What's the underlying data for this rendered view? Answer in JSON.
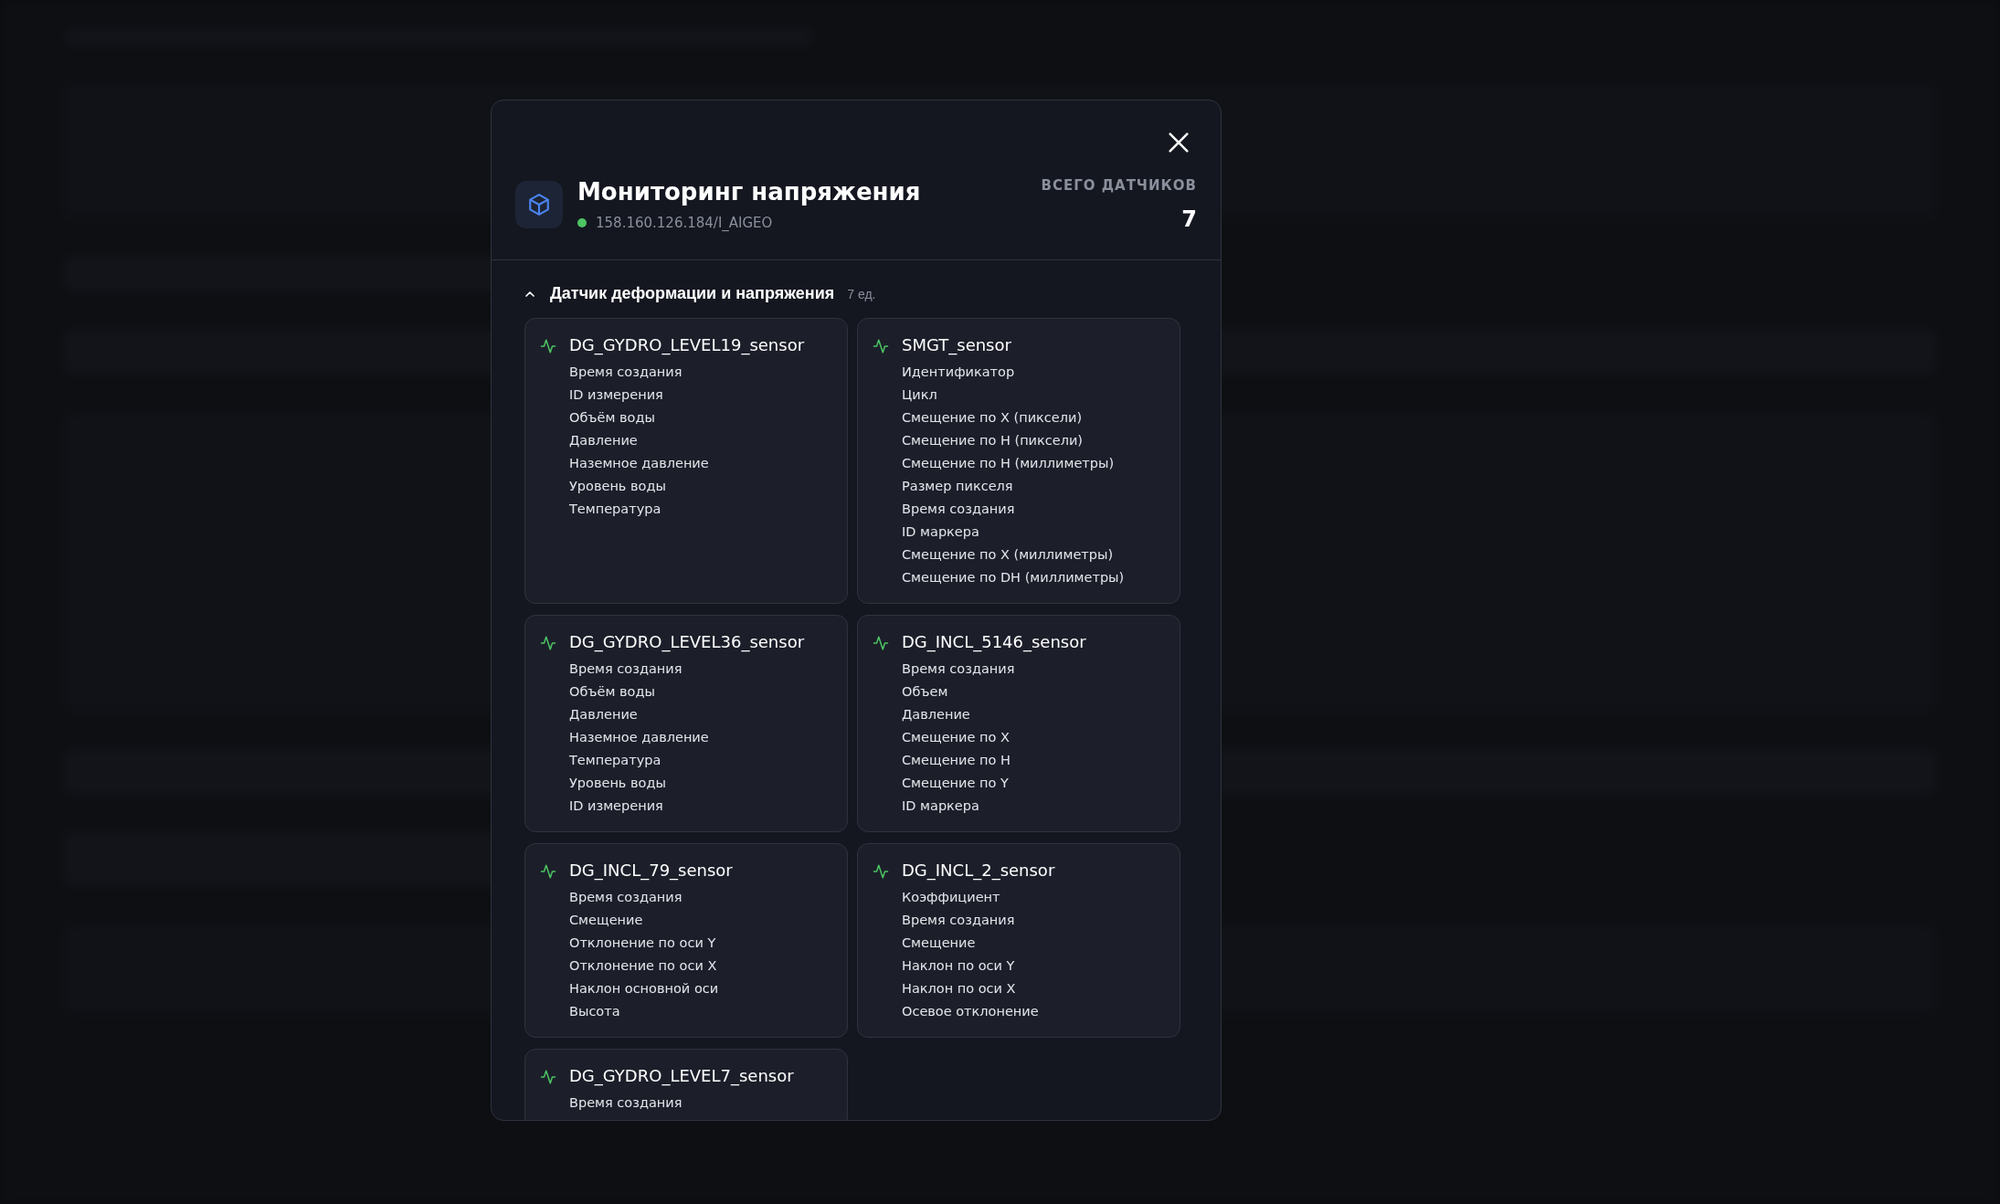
{
  "dialog": {
    "title": "Мониторинг напряжения",
    "address": "158.160.126.184/I_AIGEO",
    "total_label": "ВСЕГО ДАТЧИКОВ",
    "total_value": "7",
    "group": {
      "name": "Датчик деформации и напряжения",
      "count": "7 ед.",
      "expanded": true,
      "sensors": [
        {
          "name": "DG_GYDRO_LEVEL19_sensor",
          "fields": [
            "Время создания",
            "ID измерения",
            "Объём воды",
            "Давление",
            "Наземное давление",
            "Уровень воды",
            "Температура"
          ]
        },
        {
          "name": "SMGT_sensor",
          "fields": [
            "Идентификатор",
            "Цикл",
            "Смещение по X (пиксели)",
            "Смещение по H (пиксели)",
            "Смещение по H (миллиметры)",
            "Размер пикселя",
            "Время создания",
            "ID маркера",
            "Смещение по X (миллиметры)",
            "Смещение по DH (миллиметры)"
          ]
        },
        {
          "name": "DG_GYDRO_LEVEL36_sensor",
          "fields": [
            "Время создания",
            "Объём воды",
            "Давление",
            "Наземное давление",
            "Температура",
            "Уровень воды",
            "ID измерения"
          ]
        },
        {
          "name": "DG_INCL_5146_sensor",
          "fields": [
            "Время создания",
            "Объем",
            "Давление",
            "Смещение по X",
            "Смещение по H",
            "Смещение по Y",
            "ID маркера"
          ]
        },
        {
          "name": "DG_INCL_79_sensor",
          "fields": [
            "Время создания",
            "Смещение",
            "Отклонение по оси Y",
            "Отклонение по оси X",
            "Наклон основной оси",
            "Высота"
          ]
        },
        {
          "name": "DG_INCL_2_sensor",
          "fields": [
            "Коэффициент",
            "Время создания",
            "Смещение",
            "Наклон по оси Y",
            "Наклон по оси X",
            "Осевое отклонение"
          ]
        },
        {
          "name": "DG_GYDRO_LEVEL7_sensor",
          "fields": [
            "Время создания"
          ]
        }
      ]
    }
  }
}
